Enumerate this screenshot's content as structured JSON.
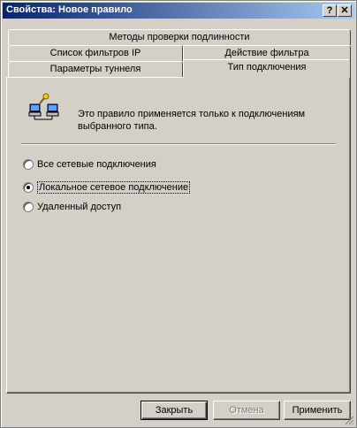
{
  "window": {
    "title": "Свойства: Новое правило"
  },
  "titlebar": {
    "help_label": "?",
    "close_label": "✕"
  },
  "tabs": [
    {
      "label": "Методы проверки подлинности",
      "active": false
    },
    {
      "label": "Список фильтров IP",
      "active": false
    },
    {
      "label": "Действие фильтра",
      "active": false
    },
    {
      "label": "Параметры туннеля",
      "active": false
    },
    {
      "label": "Тип подключения",
      "active": true
    }
  ],
  "panel": {
    "icon": "network-computers-key-icon",
    "description": "Это правило применяется только к подключениям выбранного типа.",
    "options": [
      {
        "label": "Все сетевые подключения",
        "selected": false
      },
      {
        "label": "Локальное сетевое подключение",
        "selected": true
      },
      {
        "label": "Удаленный доступ",
        "selected": false
      }
    ]
  },
  "buttons": {
    "close_label": "Закрыть",
    "cancel_label": "Отмена",
    "apply_label": "Применить"
  }
}
